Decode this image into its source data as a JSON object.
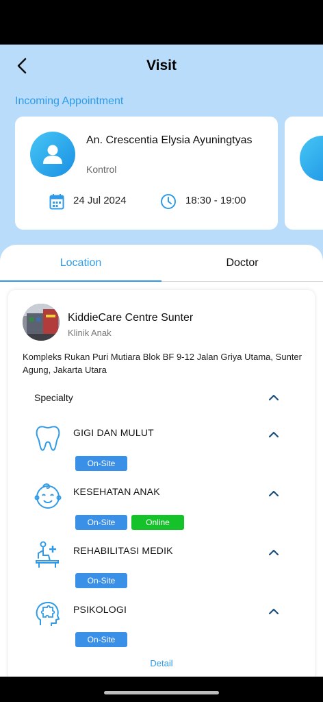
{
  "header": {
    "title": "Visit"
  },
  "appointments": {
    "section_label": "Incoming Appointment",
    "card": {
      "patient_name": "An. Crescentia Elysia Ayuningtyas",
      "visit_type": "Kontrol",
      "date": "24 Jul 2024",
      "time": "18:30 - 19:00"
    }
  },
  "tabs": [
    {
      "label": "Location",
      "active": true
    },
    {
      "label": "Doctor",
      "active": false
    }
  ],
  "clinic": {
    "name": "KiddieCare Centre Sunter",
    "type": "Klinik Anak",
    "address": "Kompleks Rukan Puri Mutiara Blok BF 9-12 Jalan Griya Utama, Sunter Agung, Jakarta Utara"
  },
  "specialty": {
    "header": "Specialty",
    "items": [
      {
        "name": "GIGI DAN MULUT",
        "icon": "tooth-icon",
        "badges": [
          "On-Site"
        ]
      },
      {
        "name": "KESEHATAN ANAK",
        "icon": "baby-face-icon",
        "badges": [
          "On-Site",
          "Online"
        ]
      },
      {
        "name": "REHABILITASI MEDIK",
        "icon": "rehabilitation-icon",
        "badges": [
          "On-Site"
        ]
      },
      {
        "name": "PSIKOLOGI",
        "icon": "puzzle-head-icon",
        "badges": [
          "On-Site"
        ]
      }
    ]
  },
  "detail_link": "Detail",
  "colors": {
    "accent": "#2f9be8",
    "onsite": "#3a8fe6",
    "online": "#16c22a",
    "header_bg": "#b9dcfa"
  }
}
